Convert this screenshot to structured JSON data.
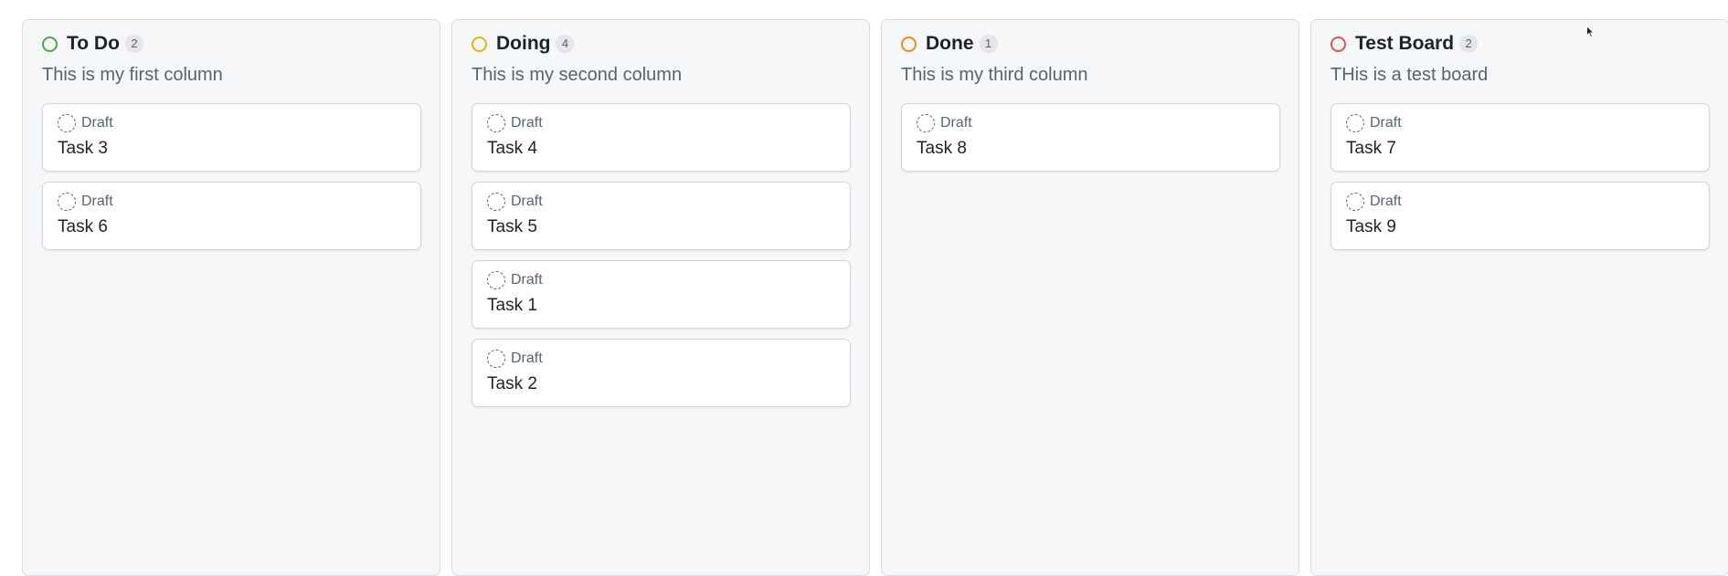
{
  "columns": [
    {
      "title": "To Do",
      "count": "2",
      "color": "#54a34a",
      "description": "This is my first column",
      "cards": [
        {
          "status": "Draft",
          "title": "Task 3"
        },
        {
          "status": "Draft",
          "title": "Task 6"
        }
      ]
    },
    {
      "title": "Doing",
      "count": "4",
      "color": "#e3b60f",
      "description": "This is my second column",
      "cards": [
        {
          "status": "Draft",
          "title": "Task 4"
        },
        {
          "status": "Draft",
          "title": "Task 5"
        },
        {
          "status": "Draft",
          "title": "Task 1"
        },
        {
          "status": "Draft",
          "title": "Task 2"
        }
      ]
    },
    {
      "title": "Done",
      "count": "1",
      "color": "#ec8c1e",
      "description": "This is my third column",
      "cards": [
        {
          "status": "Draft",
          "title": "Task 8"
        }
      ]
    },
    {
      "title": "Test Board",
      "count": "2",
      "color": "#e0534f",
      "description": "THis is a test board",
      "cards": [
        {
          "status": "Draft",
          "title": "Task 7"
        },
        {
          "status": "Draft",
          "title": "Task 9"
        }
      ]
    }
  ],
  "icons": {
    "column_status": "circle-outline-icon",
    "card_status": "dashed-circle-draft-icon",
    "cursor": "mouse-pointer-icon"
  }
}
